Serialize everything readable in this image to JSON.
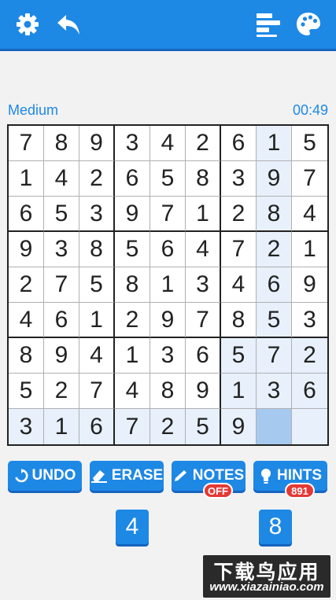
{
  "header": {
    "icons": [
      "gear-icon",
      "back-icon",
      "stats-icon",
      "palette-icon"
    ]
  },
  "difficulty": "Medium",
  "timer": "00:49",
  "board": [
    [
      "7",
      "8",
      "9",
      "3",
      "4",
      "2",
      "6",
      "1",
      "5"
    ],
    [
      "1",
      "4",
      "2",
      "6",
      "5",
      "8",
      "3",
      "9",
      "7"
    ],
    [
      "6",
      "5",
      "3",
      "9",
      "7",
      "1",
      "2",
      "8",
      "4"
    ],
    [
      "9",
      "3",
      "8",
      "5",
      "6",
      "4",
      "7",
      "2",
      "1"
    ],
    [
      "2",
      "7",
      "5",
      "8",
      "1",
      "3",
      "4",
      "6",
      "9"
    ],
    [
      "4",
      "6",
      "1",
      "2",
      "9",
      "7",
      "8",
      "5",
      "3"
    ],
    [
      "8",
      "9",
      "4",
      "1",
      "3",
      "6",
      "5",
      "7",
      "2"
    ],
    [
      "5",
      "2",
      "7",
      "4",
      "8",
      "9",
      "1",
      "3",
      "6"
    ],
    [
      "3",
      "1",
      "6",
      "7",
      "2",
      "5",
      "9",
      "",
      ""
    ]
  ],
  "selected_cell": {
    "row": 9,
    "col": 8
  },
  "colors": {
    "accent": "#1e88e5",
    "accent_dark": "#1565c0",
    "highlight": "#e7f0fb",
    "selected": "#a6c9f0",
    "badge": "#e53935"
  },
  "actions": {
    "undo": "UNDO",
    "erase": "ERASE",
    "notes": "NOTES",
    "notes_state": "OFF",
    "hints": "HINTS",
    "hints_count": "891"
  },
  "number_keys": [
    "4",
    "8"
  ],
  "watermark": {
    "main": "下载鸟应用",
    "sub": "www.xiazainiao.com"
  }
}
